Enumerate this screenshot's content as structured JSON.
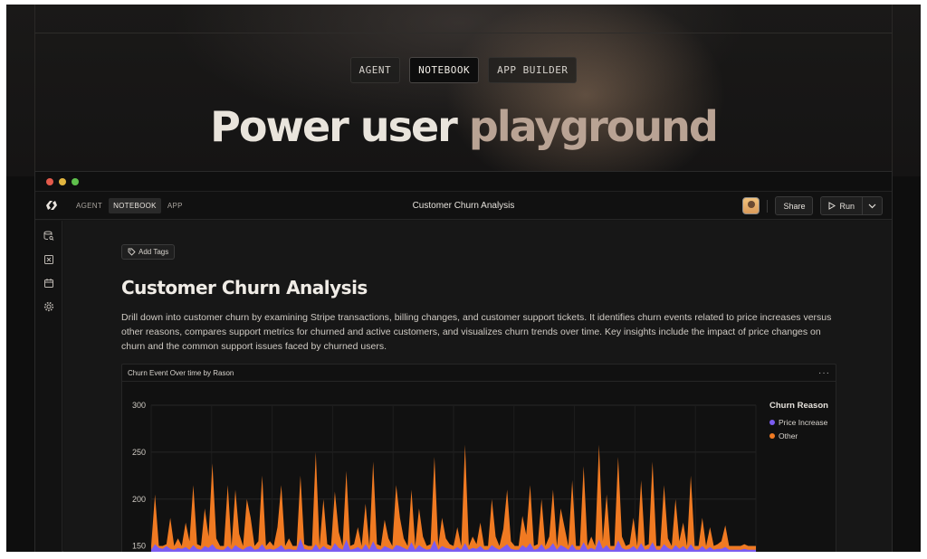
{
  "hero": {
    "tabs": [
      "AGENT",
      "NOTEBOOK",
      "APP BUILDER"
    ],
    "active_tab": "NOTEBOOK",
    "title_main": "Power user ",
    "title_accent": "playground"
  },
  "app": {
    "mode_tabs": [
      "AGENT",
      "NOTEBOOK",
      "APP"
    ],
    "active_mode": "NOTEBOOK",
    "doc_title": "Customer Churn Analysis",
    "share_label": "Share",
    "run_label": "Run"
  },
  "sidebar": {
    "icons": [
      "database-search-icon",
      "excel-file-icon",
      "calendar-icon",
      "settings-gear-icon"
    ]
  },
  "notebook": {
    "add_tags_label": "Add Tags",
    "heading": "Customer Churn Analysis",
    "description": "Drill down into customer churn by examining Stripe transactions, billing changes, and customer support tickets. It identifies churn events related to price increases versus other reasons, compares support metrics for churned and active customers, and visualizes churn trends over time. Key insights include the impact of price changes on churn and the common support issues faced by churned users.",
    "chart_title": "Churn Event Over time by Rason",
    "more_label": "···"
  },
  "colors": {
    "price_increase": "#7b5cf0",
    "other": "#f07a22",
    "accent": "#b9a394"
  },
  "chart_data": {
    "type": "area",
    "title": "Churn Event Over time by Rason",
    "legend_title": "Churn Reason",
    "legend_position": "right",
    "y_ticks": [
      "300",
      "250",
      "200",
      "150"
    ],
    "ylim": [
      140,
      300
    ],
    "grid": true,
    "series": [
      {
        "name": "Other",
        "color": "#f07a22",
        "values": [
          150,
          205,
          150,
          150,
          152,
          180,
          150,
          158,
          150,
          175,
          155,
          215,
          152,
          150,
          190,
          160,
          238,
          158,
          150,
          150,
          215,
          150,
          210,
          163,
          150,
          200,
          180,
          150,
          155,
          225,
          150,
          155,
          150,
          170,
          215,
          150,
          158,
          150,
          150,
          225,
          152,
          150,
          150,
          250,
          150,
          200,
          152,
          150,
          208,
          165,
          150,
          230,
          150,
          152,
          170,
          150,
          195,
          150,
          240,
          152,
          150,
          178,
          158,
          150,
          215,
          180,
          158,
          150,
          210,
          150,
          190,
          160,
          150,
          152,
          245,
          150,
          180,
          158,
          152,
          150,
          170,
          150,
          258,
          150,
          160,
          152,
          175,
          150,
          150,
          200,
          160,
          150,
          168,
          210,
          155,
          150,
          150,
          182,
          162,
          215,
          150,
          152,
          200,
          150,
          160,
          210,
          150,
          190,
          170,
          150,
          220,
          150,
          150,
          235,
          150,
          160,
          150,
          258,
          155,
          205,
          150,
          150,
          245,
          160,
          150,
          152,
          180,
          150,
          220,
          150,
          152,
          240,
          150,
          150,
          215,
          158,
          150,
          200,
          155,
          175,
          150,
          225,
          150,
          150,
          180,
          150,
          170,
          150,
          152,
          155,
          172,
          150,
          150,
          150,
          150,
          152,
          150,
          150,
          150
        ]
      },
      {
        "name": "Price Increase",
        "color": "#7b5cf0",
        "values": [
          146,
          152,
          148,
          147,
          150,
          147,
          146,
          148,
          147,
          149,
          146,
          151,
          147,
          146,
          150,
          148,
          152,
          147,
          146,
          146,
          150,
          146,
          151,
          148,
          146,
          149,
          150,
          146,
          147,
          152,
          146,
          147,
          146,
          148,
          151,
          146,
          147,
          146,
          146,
          158,
          147,
          146,
          146,
          152,
          146,
          150,
          147,
          146,
          153,
          148,
          146,
          157,
          146,
          147,
          149,
          146,
          152,
          146,
          155,
          147,
          146,
          150,
          148,
          146,
          151,
          150,
          148,
          146,
          154,
          146,
          151,
          148,
          146,
          147,
          156,
          146,
          150,
          148,
          147,
          146,
          149,
          146,
          153,
          146,
          148,
          147,
          150,
          146,
          146,
          151,
          148,
          146,
          149,
          152,
          147,
          146,
          146,
          151,
          148,
          153,
          146,
          147,
          152,
          146,
          148,
          153,
          146,
          151,
          149,
          146,
          152,
          146,
          146,
          154,
          146,
          148,
          146,
          157,
          147,
          151,
          146,
          146,
          156,
          148,
          146,
          147,
          150,
          146,
          153,
          146,
          147,
          154,
          146,
          146,
          152,
          148,
          146,
          151,
          147,
          150,
          146,
          152,
          146,
          146,
          150,
          146,
          149,
          146,
          147,
          147,
          149,
          146,
          146,
          146,
          146,
          147,
          146,
          146,
          146
        ]
      }
    ]
  }
}
